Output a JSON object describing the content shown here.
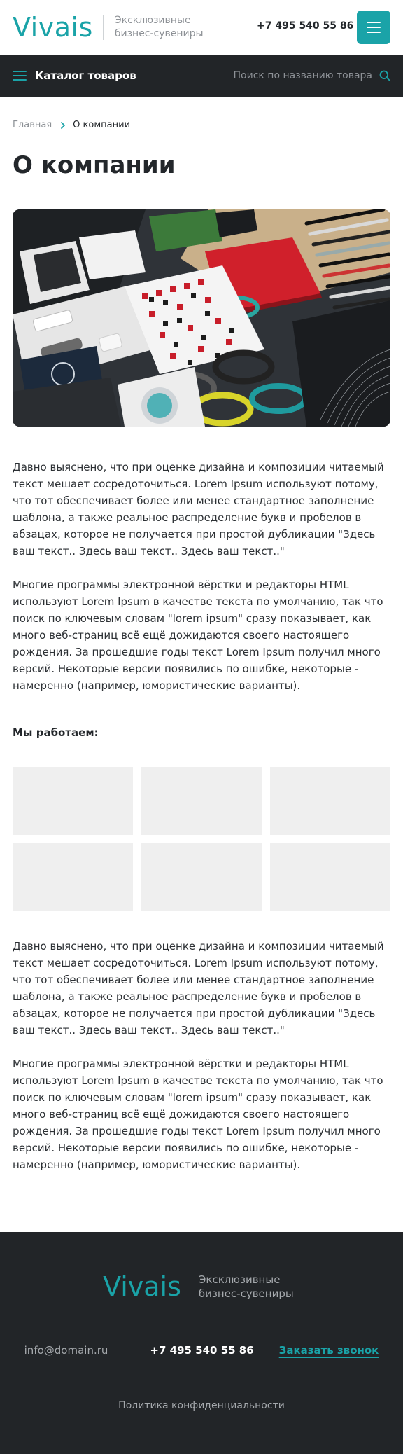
{
  "header": {
    "logo": "Vivais",
    "tagline_line1": "Эксклюзивные",
    "tagline_line2": "бизнес-сувениры",
    "phone": "+7 495 540 55 86",
    "menu_icon": "burger-menu-icon",
    "accent_color": "#1aa3a8"
  },
  "catalog_bar": {
    "label": "Каталог товаров",
    "menu_icon": "list-menu-icon",
    "search_placeholder": "Поиск по названию товара",
    "search_value": "",
    "search_icon": "search-icon",
    "background_color": "#222528"
  },
  "breadcrumb": {
    "home": "Главная",
    "separator_icon": "chevron-right-icon",
    "current": "О компании"
  },
  "page": {
    "title": "О компании",
    "hero_image": "photo of assorted branded business souvenirs: notebooks, pens, fitness bands, flash drives",
    "paragraph1": "Давно выяснено, что при оценке дизайна и композиции читаемый текст мешает сосредоточиться. Lorem Ipsum используют потому, что тот обеспечивает более или менее стандартное заполнение шаблона, а также реальное распределение букв и пробелов в абзацах, которое не получается при простой дубликации \"Здесь ваш текст.. Здесь ваш текст.. Здесь ваш текст..\"",
    "paragraph2": "Многие программы электронной вёрстки и редакторы HTML используют Lorem Ipsum в качестве текста по умолчанию, так что поиск по ключевым словам \"lorem ipsum\" сразу показывает, как много веб-страниц всё ещё дожидаются своего настоящего рождения. За прошедшие годы текст Lorem Ipsum получил много версий. Некоторые версии появились по ошибке, некоторые - намеренно (например, юмористические варианты).",
    "section_label": "Мы работаем:",
    "client_logo_count": 6,
    "paragraph3": "Давно выяснено, что при оценке дизайна и композиции читаемый текст мешает сосредоточиться. Lorem Ipsum используют потому, что тот обеспечивает более или менее стандартное заполнение шаблона, а также реальное распределение букв и пробелов в абзацах, которое не получается при простой дубликации \"Здесь ваш текст.. Здесь ваш текст.. Здесь ваш текст..\"",
    "paragraph4": "Многие программы электронной вёрстки и редакторы HTML используют Lorem Ipsum в качестве текста по умолчанию, так что поиск по ключевым словам \"lorem ipsum\" сразу показывает, как много веб-страниц всё ещё дожидаются своего настоящего рождения. За прошедшие годы текст Lorem Ipsum получил много версий. Некоторые версии появились по ошибке, некоторые - намеренно (например, юмористические варианты)."
  },
  "footer": {
    "logo": "Vivais",
    "tagline_line1": "Эксклюзивные",
    "tagline_line2": "бизнес-сувениры",
    "email": "info@domain.ru",
    "phone": "+7 495 540 55 86",
    "callback_label": "Заказать звонок",
    "privacy_label": "Политика конфиденциальности"
  }
}
